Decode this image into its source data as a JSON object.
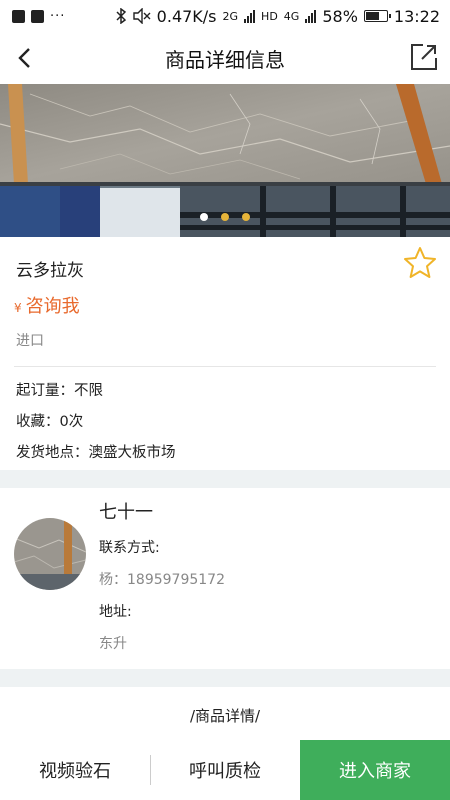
{
  "status_bar": {
    "speed": "0.47K/s",
    "net_2g": "2G",
    "hd": "HD",
    "net_4g": "4G",
    "battery": "58%",
    "time": "13:22"
  },
  "header": {
    "title": "商品详细信息"
  },
  "gallery": {
    "slide_count": 3,
    "active_index": 0
  },
  "product": {
    "name": "云多拉灰",
    "currency": "¥",
    "price_text": "咨询我",
    "origin": "进口",
    "min_order": "起订量：不限",
    "favorites": "收藏：0次",
    "ship_from": "发货地点：澳盛大板市场"
  },
  "seller": {
    "name": "七十一",
    "contact_label": "联系方式:",
    "contact_value": "杨：18959795172",
    "address_label": "地址:",
    "address_value": "东升"
  },
  "details": {
    "heading": "/商品详情/"
  },
  "bottom_bar": {
    "video_label": "视频验石",
    "call_label": "呼叫质检",
    "enter_label": "进入商家"
  },
  "colors": {
    "accent_green": "#3fae5b",
    "price_orange": "#e8692c",
    "star_yellow": "#f0b428"
  }
}
